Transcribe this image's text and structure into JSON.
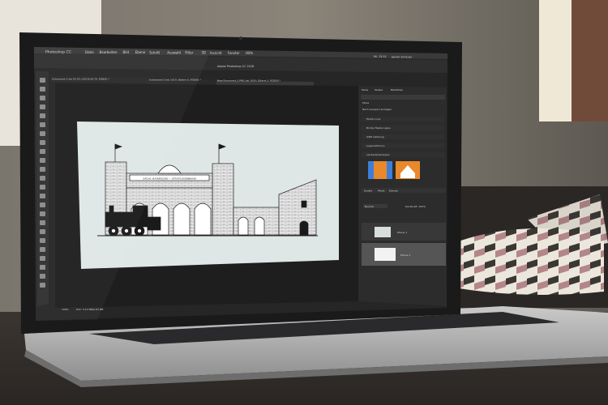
{
  "menubar": {
    "app_name": "Photoshop CC",
    "items": [
      "Datei",
      "Bearbeiten",
      "Bild",
      "Ebene",
      "Schrift",
      "Auswahl",
      "Filter",
      "3D",
      "Ansicht",
      "Fenster",
      "Hilfe"
    ],
    "clock": "Mi. 13:51",
    "user": "Jannik Scheuer"
  },
  "window_title": "Adobe Photoshop CC 2018",
  "document_tabs": [
    "Unbenannt-1 bei 83,5% (GGC8,58,79, RGB/8) *",
    "Unbenannt-2 bei 101% (Ebene 0, RGB/8) *",
    "New Document_1.PNG bei 100% (Ebene 2, RGB/8) *"
  ],
  "artwork": {
    "sign_text": "SÄCHS.-BAYERISCHE — STAATS-EISENBAHN"
  },
  "right_panel": {
    "top_tabs": [
      "Farbe",
      "Muster",
      "Bibliothek"
    ],
    "swatch_label": "Farbe",
    "library_label": "Nach Gruppen anzeigen",
    "sections": [
      "FiDAS icons",
      "Border Media Logos",
      "OWP Lettering",
      "Jugendstilicons",
      "Landesfarbenlogos"
    ],
    "layer_tabs": [
      "Kanäle",
      "Pfade",
      "Ebenen"
    ],
    "blend_mode": "Normal",
    "opacity_label": "Deckkraft: 100%",
    "layers": [
      "Ebene 1",
      "Ebene 2"
    ]
  },
  "status_bar": {
    "zoom": "100%",
    "doc_size": "Dok: 5,13 MB/6,84 MB"
  },
  "colors": {
    "photoshop_ui": "#2b2b2b",
    "canvas_paper": "#dfe6e6",
    "accent_blue": "#3d7fd8",
    "swatch_orange": "#e9892c"
  }
}
